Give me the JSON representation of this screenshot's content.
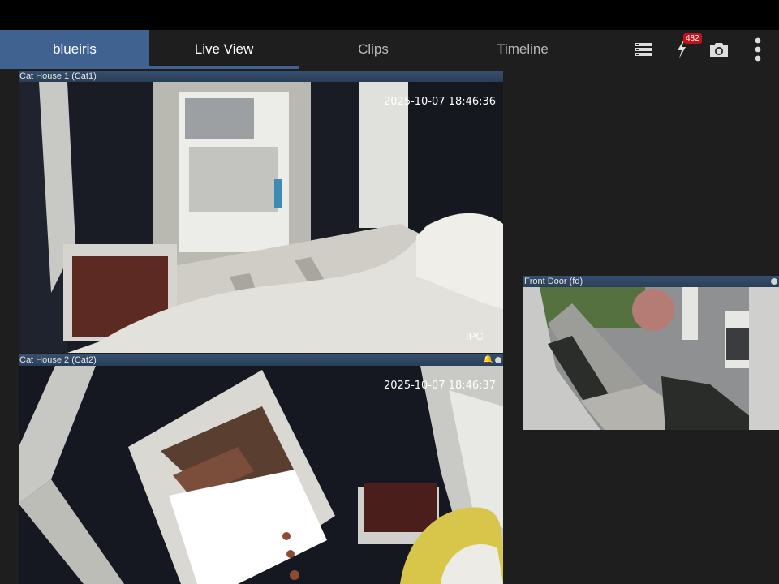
{
  "nav": {
    "brand": "blueiris",
    "tabs": [
      {
        "label": "Live View",
        "active": true
      },
      {
        "label": "Clips",
        "active": false
      },
      {
        "label": "Timeline",
        "active": false
      }
    ],
    "icons": [
      "list-icon",
      "lightning-icon",
      "camera-icon",
      "more-vert-icon"
    ],
    "alert_count": "482",
    "accent": "#3f6291",
    "badge_color": "#c0141a"
  },
  "cameras": [
    {
      "title": "Cat House 1 (Cat1)",
      "timestamp": "2025-10-07 18:46:36",
      "overlay": "IPC"
    },
    {
      "title": "Cat House 2 (Cat2)",
      "timestamp": "2025-10-07 18:46:37"
    },
    {
      "title": "Front Door (fd)"
    }
  ]
}
